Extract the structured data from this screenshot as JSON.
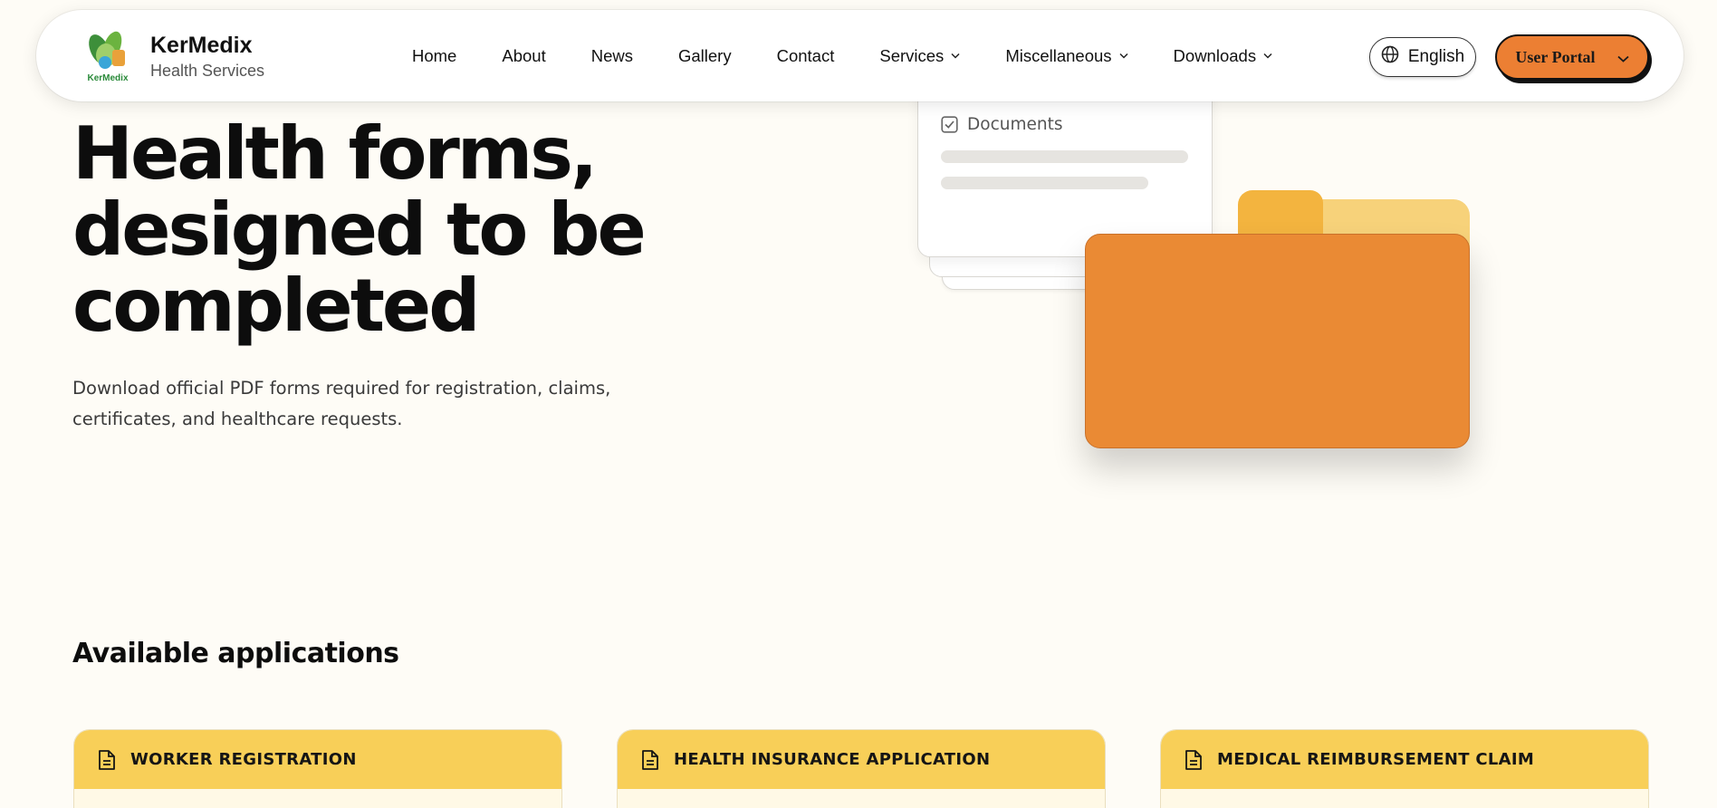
{
  "brand": {
    "name": "KerMedix",
    "subtitle": "Health Services",
    "logo_text": "KerMedix"
  },
  "nav": {
    "items": [
      {
        "label": "Home",
        "has_dropdown": false
      },
      {
        "label": "About",
        "has_dropdown": false
      },
      {
        "label": "News",
        "has_dropdown": false
      },
      {
        "label": "Gallery",
        "has_dropdown": false
      },
      {
        "label": "Contact",
        "has_dropdown": false
      },
      {
        "label": "Services",
        "has_dropdown": true
      },
      {
        "label": "Miscellaneous",
        "has_dropdown": true
      },
      {
        "label": "Downloads",
        "has_dropdown": true
      }
    ],
    "language_label": "English",
    "portal_label": "User Portal"
  },
  "hero": {
    "title_line1": "Health forms,",
    "title_line2": "designed to be",
    "title_line3": "completed",
    "description": "Download official PDF forms required for registration, claims, certificates, and healthcare requests.",
    "illustration_label": "Documents"
  },
  "applications": {
    "heading": "Available applications",
    "cards": [
      {
        "title": "WORKER REGISTRATION",
        "icon": "document-icon"
      },
      {
        "title": "HEALTH INSURANCE APPLICATION",
        "icon": "document-icon"
      },
      {
        "title": "MEDICAL REIMBURSEMENT CLAIM",
        "icon": "document-icon"
      }
    ]
  },
  "colors": {
    "accent_orange": "#ec7f33",
    "card_header_yellow": "#f8cf58",
    "page_background": "#fefcf6",
    "folder_orange": "#ea8a34"
  }
}
